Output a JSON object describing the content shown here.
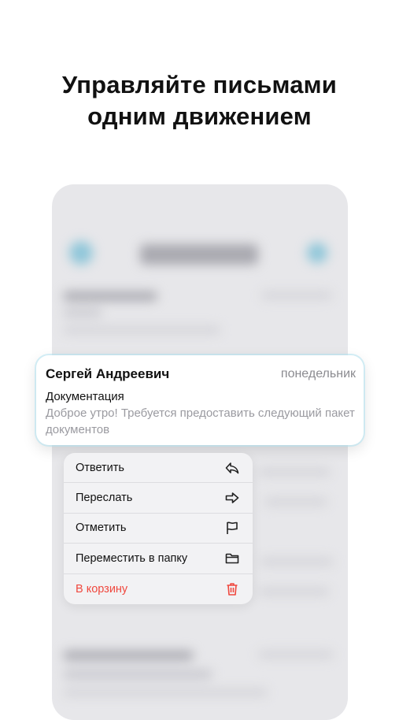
{
  "headline": {
    "line1": "Управляйте письмами",
    "line2": "одним движением"
  },
  "email": {
    "sender": "Сергей Андреевич",
    "date": "понедельник",
    "subject": "Документация",
    "preview": "Доброе утро! Требуется предоставить следующий пакет документов"
  },
  "menu": {
    "items": [
      {
        "label": "Ответить",
        "icon": "reply-icon"
      },
      {
        "label": "Переслать",
        "icon": "forward-icon"
      },
      {
        "label": "Отметить",
        "icon": "flag-icon"
      },
      {
        "label": "Переместить в папку",
        "icon": "folder-icon"
      },
      {
        "label": "В корзину",
        "icon": "trash-icon"
      }
    ],
    "danger_color": "#f0483e"
  }
}
